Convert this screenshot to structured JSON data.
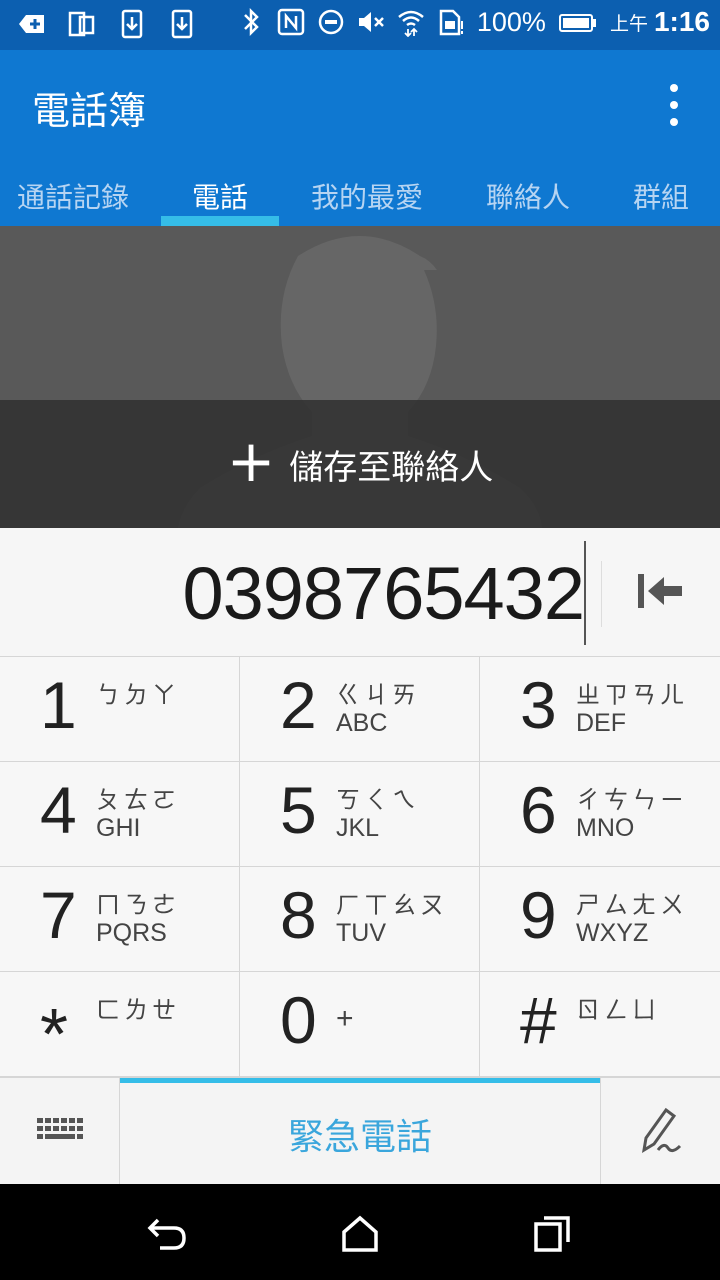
{
  "status_bar": {
    "battery_percent": "100%",
    "time_prefix": "上午",
    "time": "1:16"
  },
  "app_bar": {
    "title": "電話簿"
  },
  "tabs": [
    {
      "label": "通話記錄",
      "active": false
    },
    {
      "label": "電話",
      "active": true
    },
    {
      "label": "我的最愛",
      "active": false
    },
    {
      "label": "聯絡人",
      "active": false
    },
    {
      "label": "群組",
      "active": false
    }
  ],
  "contact": {
    "save_label": "儲存至聯絡人"
  },
  "dialer": {
    "number": "0398765432"
  },
  "keys": [
    {
      "digit": "1",
      "zhuyin": "ㄅㄉㄚ",
      "latin": ""
    },
    {
      "digit": "2",
      "zhuyin": "ㄍㄐㄞ",
      "latin": "ABC"
    },
    {
      "digit": "3",
      "zhuyin": "ㄓㄗㄢㄦ",
      "latin": "DEF"
    },
    {
      "digit": "4",
      "zhuyin": "ㄆㄊㄛ",
      "latin": "GHI"
    },
    {
      "digit": "5",
      "zhuyin": "ㄎㄑㄟ",
      "latin": "JKL"
    },
    {
      "digit": "6",
      "zhuyin": "ㄔㄘㄣㄧ",
      "latin": "MNO"
    },
    {
      "digit": "7",
      "zhuyin": "ㄇㄋㄜ",
      "latin": "PQRS"
    },
    {
      "digit": "8",
      "zhuyin": "ㄏㄒㄠㄡ",
      "latin": "TUV"
    },
    {
      "digit": "9",
      "zhuyin": "ㄕㄙㄤㄨ",
      "latin": "WXYZ"
    },
    {
      "digit": "*",
      "zhuyin": "ㄈㄌㄝ",
      "latin": ""
    },
    {
      "digit": "0",
      "zhuyin": "",
      "latin": "",
      "sym": "+"
    },
    {
      "digit": "#",
      "zhuyin": "ㄖㄥㄩ",
      "latin": ""
    }
  ],
  "bottom": {
    "emergency_label": "緊急電話"
  },
  "colors": {
    "status_bar": "#0c5fb0",
    "app_bar": "#0f78d1",
    "accent": "#35bde8",
    "emergency_text": "#3aa6dc"
  }
}
